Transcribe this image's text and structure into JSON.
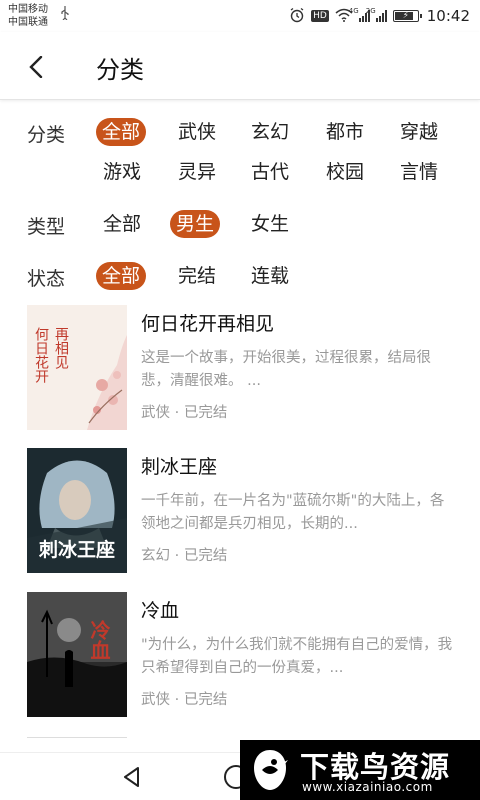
{
  "status_bar": {
    "carrier_1": "中国移动",
    "carrier_2": "中国联通",
    "hd": "HD",
    "net_1": "4G",
    "net_2": "2G",
    "time": "10:42",
    "battery_level": 0.85
  },
  "header": {
    "title": "分类"
  },
  "filters": {
    "category": {
      "label": "分类",
      "options": [
        "全部",
        "武侠",
        "玄幻",
        "都市",
        "穿越",
        "游戏",
        "灵异",
        "古代",
        "校园",
        "言情"
      ],
      "selected": "全部"
    },
    "type": {
      "label": "类型",
      "options": [
        "全部",
        "男生",
        "女生"
      ],
      "selected": "男生"
    },
    "status": {
      "label": "状态",
      "options": [
        "全部",
        "完结",
        "连载"
      ],
      "selected": "全部"
    }
  },
  "books": [
    {
      "title": "何日花开再相见",
      "desc": "这是一个故事，开始很美，过程很累，结局很悲，清醒很难。 ...",
      "meta": "武侠 · 已完结",
      "cover_text_a": "再相见",
      "cover_text_b": "何日花开"
    },
    {
      "title": "刺冰王座",
      "desc": "一千年前，在一片名为\"蓝硫尔斯\"的大陆上，各领地之间都是兵刃相见，长期的...",
      "meta": "玄幻 · 已完结",
      "cover_text_a": "刺冰王座"
    },
    {
      "title": "冷血",
      "desc": "\"为什么，为什么我们就不能拥有自己的爱情，我只希望得到自己的一份真爱，...",
      "meta": "武侠 · 已完结",
      "cover_text_a": "冷血"
    }
  ],
  "watermark": {
    "text": "下载鸟资源",
    "url": "www.xiazainiao.com"
  },
  "colors": {
    "accent": "#c8541a",
    "muted_text": "#999999"
  }
}
